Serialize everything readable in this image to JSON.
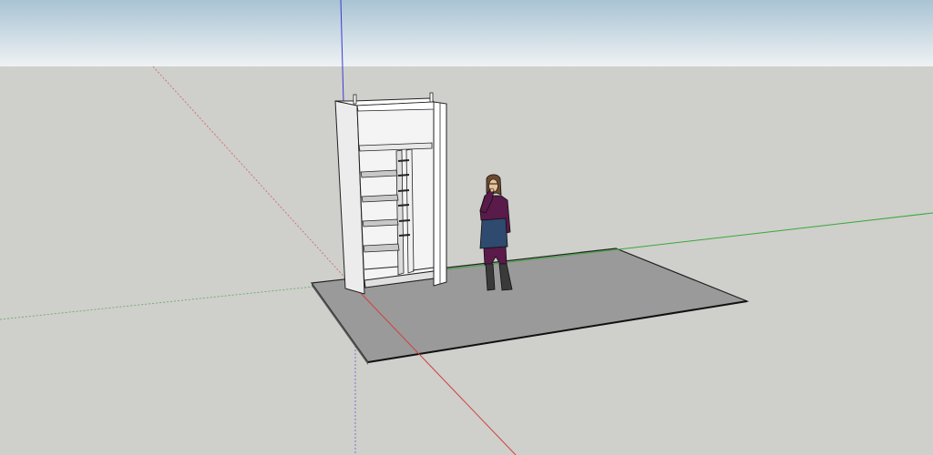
{
  "scene": {
    "sky_top_color": "#a9c3d3",
    "sky_bottom_color": "#eef2f4",
    "ground_color": "#cfcfcb",
    "axes": {
      "red": "#d04040",
      "green": "#3aa83a",
      "blue": "#3a3ad8"
    },
    "floor_color": "#9a9a9a",
    "cabinet_color": "#ffffff",
    "figure_top_color": "#5a1a4a",
    "figure_skirt_color": "#2e4a6e",
    "figure_legs_color": "#5a1a4a",
    "figure_boots_color": "#3a3a3a"
  }
}
